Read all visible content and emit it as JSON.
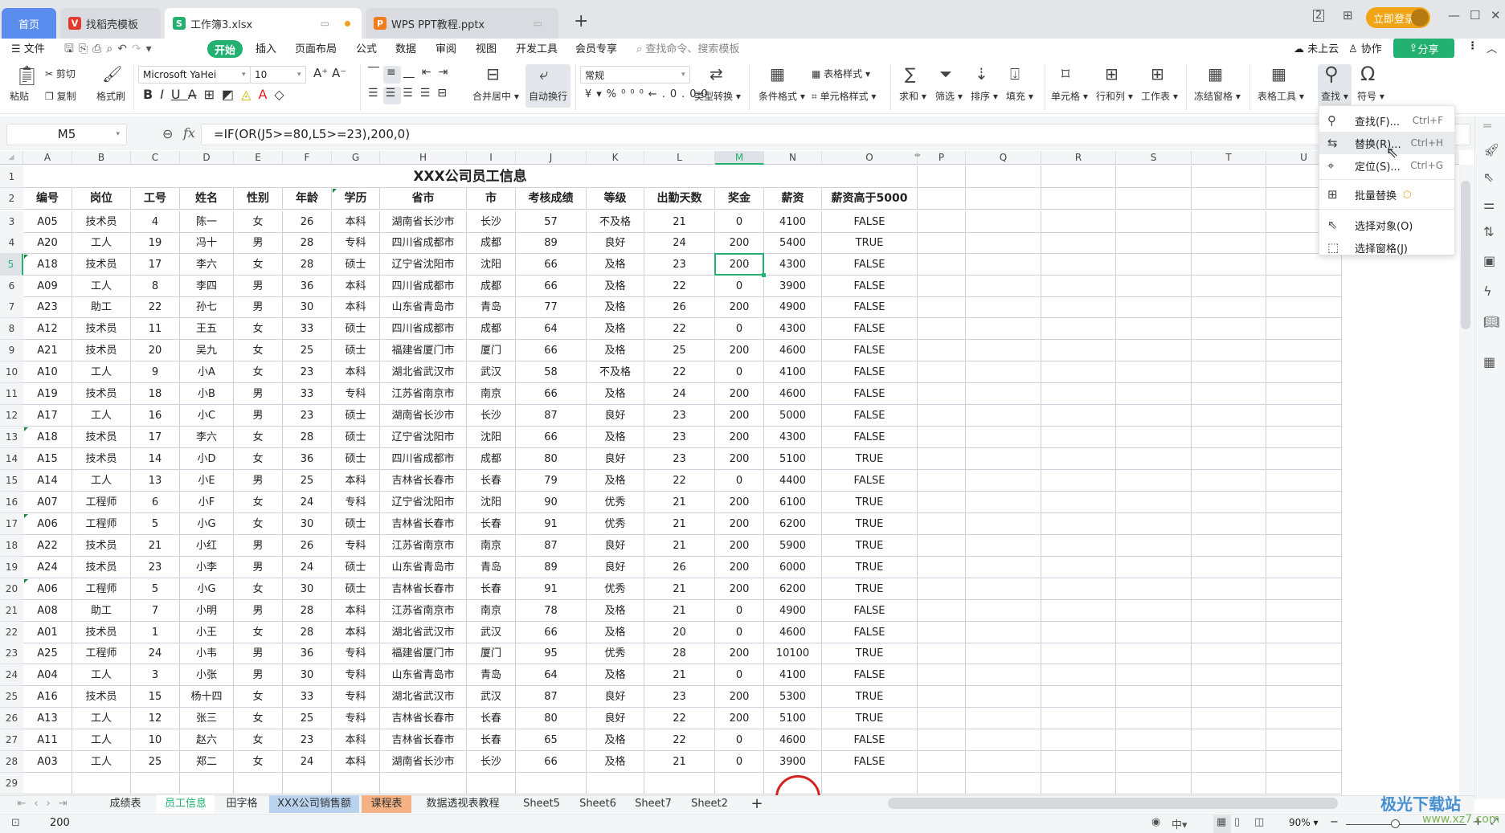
{
  "titlebar": {
    "tabs": [
      {
        "label": "首页",
        "icon": "home"
      },
      {
        "label": "找稻壳模板",
        "icon": "daoke-logo"
      },
      {
        "label": "工作簿3.xlsx",
        "icon": "spreadsheet-s-icon"
      },
      {
        "label": "WPS PPT教程.pptx",
        "icon": "presentation-p-icon"
      }
    ],
    "login_label": "立即登录"
  },
  "menubar": {
    "file_label": "文件",
    "items": [
      "开始",
      "插入",
      "页面布局",
      "公式",
      "数据",
      "审阅",
      "视图",
      "开发工具",
      "会员专享"
    ],
    "search_placeholder": "查找命令、搜索模板",
    "cloud_label": "未上云",
    "collab_label": "协作",
    "share_label": "分享"
  },
  "ribbon": {
    "paste": "粘贴",
    "cut": "剪切",
    "copy": "复制",
    "format_painter": "格式刷",
    "font_name": "Microsoft YaHei",
    "font_size": "10",
    "merge_center": "合并居中",
    "wrap_text": "自动换行",
    "number_format": "常规",
    "type_convert": "类型转换",
    "cond_format": "条件格式",
    "table_style": "表格样式",
    "cell_style": "单元格样式",
    "sum": "求和",
    "filter": "筛选",
    "sort": "排序",
    "fill": "填充",
    "cell": "单元格",
    "row_col": "行和列",
    "worksheet": "工作表",
    "freeze": "冻结窗格",
    "table_tools": "表格工具",
    "find": "查找",
    "symbol": "符号"
  },
  "formula_bar": {
    "name_box": "M5",
    "formula": "=IF(OR(J5>=80,L5>=23),200,0)"
  },
  "find_menu": {
    "items": [
      {
        "label": "查找(F)...",
        "shortcut": "Ctrl+F",
        "icon": "search"
      },
      {
        "label": "替换(R)...",
        "shortcut": "Ctrl+H",
        "icon": "replace"
      },
      {
        "label": "定位(S)...",
        "shortcut": "Ctrl+G",
        "icon": "locate"
      },
      {
        "label": "批量替换",
        "shortcut": "",
        "icon": "batch-replace"
      },
      {
        "label": "选择对象(O)",
        "shortcut": "",
        "icon": "select-object"
      },
      {
        "label": "选择窗格(J)",
        "shortcut": "",
        "icon": "selection-pane"
      }
    ]
  },
  "sheet": {
    "columns": [
      "A",
      "B",
      "C",
      "D",
      "E",
      "F",
      "G",
      "H",
      "I",
      "J",
      "K",
      "L",
      "M",
      "N",
      "O",
      "P",
      "Q",
      "R",
      "S",
      "T",
      "U"
    ],
    "title": "XXX公司员工信息",
    "headers": [
      "编号",
      "岗位",
      "工号",
      "姓名",
      "性别",
      "年龄",
      "学历",
      "省市",
      "市",
      "考核成绩",
      "等级",
      "出勤天数",
      "奖金",
      "薪资",
      "薪资高于5000"
    ],
    "rows": [
      [
        "A05",
        "技术员",
        "4",
        "陈一",
        "女",
        "26",
        "本科",
        "湖南省长沙市",
        "长沙",
        "57",
        "不及格",
        "21",
        "0",
        "4100",
        "FALSE"
      ],
      [
        "A20",
        "工人",
        "19",
        "冯十",
        "男",
        "28",
        "专科",
        "四川省成都市",
        "成都",
        "89",
        "良好",
        "24",
        "200",
        "5400",
        "TRUE"
      ],
      [
        "A18",
        "技术员",
        "17",
        "李六",
        "女",
        "28",
        "硕士",
        "辽宁省沈阳市",
        "沈阳",
        "66",
        "及格",
        "23",
        "200",
        "4300",
        "FALSE"
      ],
      [
        "A09",
        "工人",
        "8",
        "李四",
        "男",
        "36",
        "本科",
        "四川省成都市",
        "成都",
        "66",
        "及格",
        "22",
        "0",
        "3900",
        "FALSE"
      ],
      [
        "A23",
        "助工",
        "22",
        "孙七",
        "男",
        "30",
        "本科",
        "山东省青岛市",
        "青岛",
        "77",
        "及格",
        "26",
        "200",
        "4900",
        "FALSE"
      ],
      [
        "A12",
        "技术员",
        "11",
        "王五",
        "女",
        "33",
        "硕士",
        "四川省成都市",
        "成都",
        "64",
        "及格",
        "22",
        "0",
        "4300",
        "FALSE"
      ],
      [
        "A21",
        "技术员",
        "20",
        "吴九",
        "女",
        "25",
        "硕士",
        "福建省厦门市",
        "厦门",
        "66",
        "及格",
        "25",
        "200",
        "4600",
        "FALSE"
      ],
      [
        "A10",
        "工人",
        "9",
        "小A",
        "女",
        "23",
        "本科",
        "湖北省武汉市",
        "武汉",
        "58",
        "不及格",
        "22",
        "0",
        "4100",
        "FALSE"
      ],
      [
        "A19",
        "技术员",
        "18",
        "小B",
        "男",
        "33",
        "专科",
        "江苏省南京市",
        "南京",
        "66",
        "及格",
        "24",
        "200",
        "4600",
        "FALSE"
      ],
      [
        "A17",
        "工人",
        "16",
        "小C",
        "男",
        "23",
        "硕士",
        "湖南省长沙市",
        "长沙",
        "87",
        "良好",
        "23",
        "200",
        "5000",
        "FALSE"
      ],
      [
        "A18",
        "技术员",
        "17",
        "李六",
        "女",
        "28",
        "硕士",
        "辽宁省沈阳市",
        "沈阳",
        "66",
        "及格",
        "23",
        "200",
        "4300",
        "FALSE"
      ],
      [
        "A15",
        "技术员",
        "14",
        "小D",
        "女",
        "36",
        "硕士",
        "四川省成都市",
        "成都",
        "80",
        "良好",
        "23",
        "200",
        "5100",
        "TRUE"
      ],
      [
        "A14",
        "工人",
        "13",
        "小E",
        "男",
        "25",
        "本科",
        "吉林省长春市",
        "长春",
        "79",
        "及格",
        "22",
        "0",
        "4400",
        "FALSE"
      ],
      [
        "A07",
        "工程师",
        "6",
        "小F",
        "女",
        "24",
        "专科",
        "辽宁省沈阳市",
        "沈阳",
        "90",
        "优秀",
        "21",
        "200",
        "6100",
        "TRUE"
      ],
      [
        "A06",
        "工程师",
        "5",
        "小G",
        "女",
        "30",
        "硕士",
        "吉林省长春市",
        "长春",
        "91",
        "优秀",
        "21",
        "200",
        "6200",
        "TRUE"
      ],
      [
        "A22",
        "技术员",
        "21",
        "小红",
        "男",
        "26",
        "专科",
        "江苏省南京市",
        "南京",
        "87",
        "良好",
        "21",
        "200",
        "5900",
        "TRUE"
      ],
      [
        "A24",
        "技术员",
        "23",
        "小李",
        "男",
        "24",
        "硕士",
        "山东省青岛市",
        "青岛",
        "89",
        "良好",
        "26",
        "200",
        "6000",
        "TRUE"
      ],
      [
        "A06",
        "工程师",
        "5",
        "小G",
        "女",
        "30",
        "硕士",
        "吉林省长春市",
        "长春",
        "91",
        "优秀",
        "21",
        "200",
        "6200",
        "TRUE"
      ],
      [
        "A08",
        "助工",
        "7",
        "小明",
        "男",
        "28",
        "本科",
        "江苏省南京市",
        "南京",
        "78",
        "及格",
        "21",
        "0",
        "4900",
        "FALSE"
      ],
      [
        "A01",
        "技术员",
        "1",
        "小王",
        "女",
        "28",
        "本科",
        "湖北省武汉市",
        "武汉",
        "66",
        "及格",
        "20",
        "0",
        "4600",
        "FALSE"
      ],
      [
        "A25",
        "工程师",
        "24",
        "小韦",
        "男",
        "36",
        "专科",
        "福建省厦门市",
        "厦门",
        "95",
        "优秀",
        "28",
        "200",
        "10100",
        "TRUE"
      ],
      [
        "A04",
        "工人",
        "3",
        "小张",
        "男",
        "30",
        "专科",
        "山东省青岛市",
        "青岛",
        "64",
        "及格",
        "21",
        "0",
        "4100",
        "FALSE"
      ],
      [
        "A16",
        "技术员",
        "15",
        "杨十四",
        "女",
        "33",
        "专科",
        "湖北省武汉市",
        "武汉",
        "87",
        "良好",
        "23",
        "200",
        "5300",
        "TRUE"
      ],
      [
        "A13",
        "工人",
        "12",
        "张三",
        "女",
        "25",
        "专科",
        "吉林省长春市",
        "长春",
        "80",
        "良好",
        "22",
        "200",
        "5100",
        "TRUE"
      ],
      [
        "A11",
        "工人",
        "10",
        "赵六",
        "女",
        "23",
        "本科",
        "吉林省长春市",
        "长春",
        "65",
        "及格",
        "22",
        "0",
        "4600",
        "FALSE"
      ],
      [
        "A03",
        "工人",
        "25",
        "郑二",
        "女",
        "24",
        "本科",
        "湖南省长沙市",
        "长沙",
        "66",
        "及格",
        "21",
        "0",
        "3900",
        "FALSE"
      ]
    ]
  },
  "sheet_tabs": [
    {
      "label": "成绩表",
      "color": ""
    },
    {
      "label": "员工信息",
      "color": "active"
    },
    {
      "label": "田字格",
      "color": ""
    },
    {
      "label": "XXX公司销售额",
      "color": "#b9d3ee"
    },
    {
      "label": "课程表",
      "color": "#f4b183"
    },
    {
      "label": "数据透视表教程",
      "color": ""
    },
    {
      "label": "Sheet5",
      "color": ""
    },
    {
      "label": "Sheet6",
      "color": ""
    },
    {
      "label": "Sheet7",
      "color": ""
    },
    {
      "label": "Sheet2",
      "color": ""
    }
  ],
  "statusbar": {
    "value": "200",
    "zoom": "90%",
    "watermark": "极光下载站",
    "watermark_url": "www.xz7.com"
  }
}
